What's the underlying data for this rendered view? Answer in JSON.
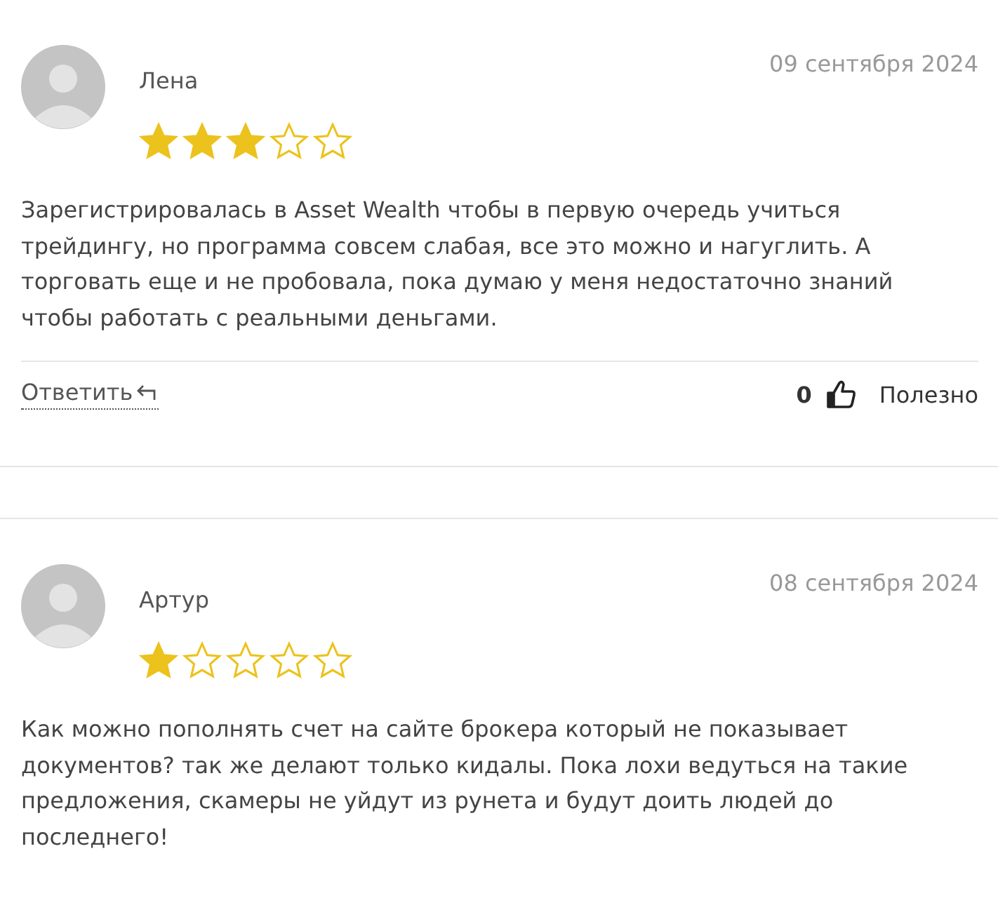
{
  "reviews": [
    {
      "author": "Лена",
      "date": "09 сентября 2024",
      "stars": 3,
      "text": "Зарегистрировалась в Asset Wealth чтобы в первую очередь учиться трейдингу, но программа совсем слабая, все это можно и нагуглить. А торговать еще и не пробовала, пока думаю у меня недостаточно знаний чтобы работать с реальными деньгами.",
      "reply": "Ответить",
      "likes": "0",
      "useful": "Полезно"
    },
    {
      "author": "Артур",
      "date": "08 сентября 2024",
      "stars": 1,
      "text": "Как можно пополнять счет на сайте брокера который не показывает документов? так же делают только кидалы. Пока лохи ведуться на такие предложения, скамеры не уйдут из рунета и будут доить людей до последнего!"
    }
  ]
}
